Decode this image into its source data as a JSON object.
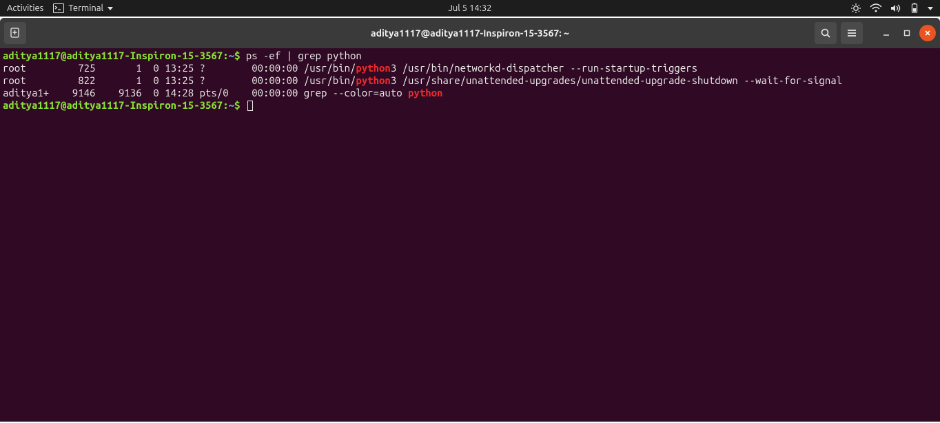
{
  "topbar": {
    "activities": "Activities",
    "app_name": "Terminal",
    "datetime": "Jul 5  14:32"
  },
  "window": {
    "title": "aditya1117@aditya1117-Inspiron-15-3567: ~"
  },
  "terminal": {
    "prompt_user_host": "aditya1117@aditya1117-Inspiron-15-3567",
    "prompt_sep": ":",
    "prompt_path": "~",
    "prompt_sigil": "$",
    "command1": "ps -ef | grep python",
    "rows": [
      {
        "pre": "root         725       1  0 13:25 ?        00:00:00 /usr/bin/",
        "hl": "python",
        "post": "3 /usr/bin/networkd-dispatcher --run-startup-triggers"
      },
      {
        "pre": "root         822       1  0 13:25 ?        00:00:00 /usr/bin/",
        "hl": "python",
        "post": "3 /usr/share/unattended-upgrades/unattended-upgrade-shutdown --wait-for-signal"
      },
      {
        "pre": "aditya1+    9146    9136  0 14:28 pts/0    00:00:00 grep --color=auto ",
        "hl": "python",
        "post": ""
      }
    ]
  }
}
